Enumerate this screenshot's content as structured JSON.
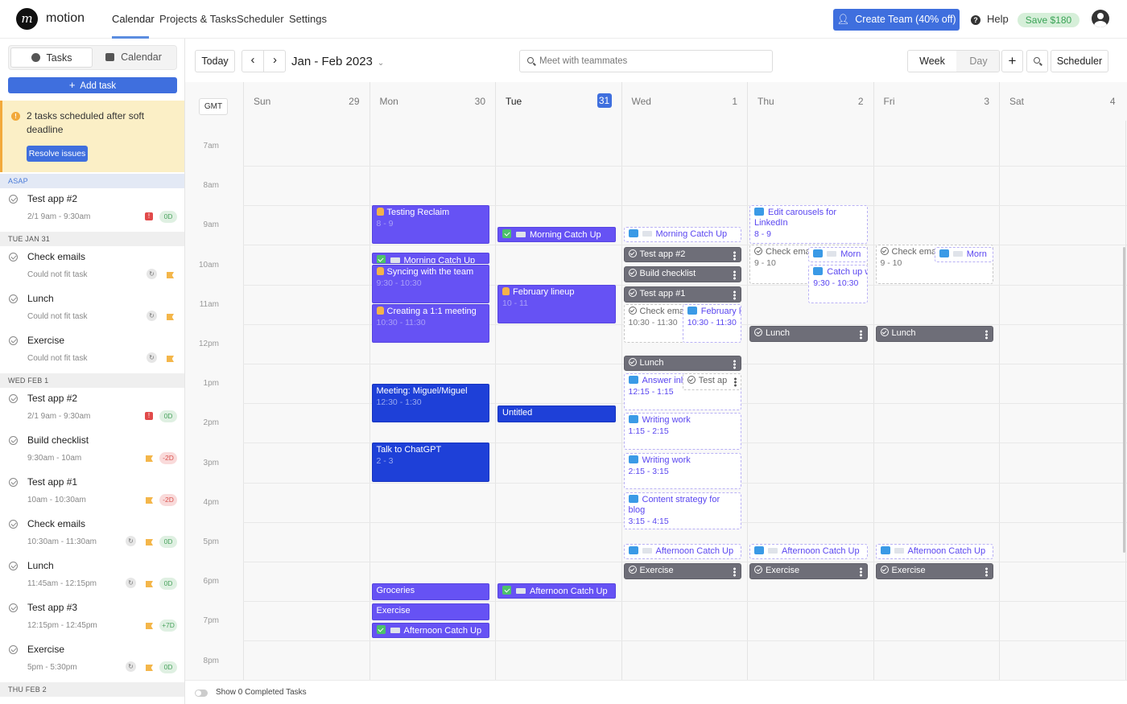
{
  "app": {
    "brand": "motion",
    "logo_glyph": "m"
  },
  "nav": {
    "items": [
      "Calendar",
      "Projects & Tasks",
      "Scheduler",
      "Settings"
    ],
    "active": "Calendar"
  },
  "header_right": {
    "create_team": "Create Team (40% off)",
    "help": "Help",
    "save": "Save $180"
  },
  "sidebar": {
    "tabs": [
      "Tasks",
      "Calendar"
    ],
    "active_tab": "Tasks",
    "add_task": "Add task",
    "warning": {
      "text": "2 tasks scheduled after soft deadline",
      "button": "Resolve issues"
    },
    "sections": [
      {
        "label": "ASAP",
        "tasks": [
          {
            "name": "Test app #2",
            "sub": "2/1 9am - 9:30am",
            "badges": [
              "error"
            ],
            "day": "0D",
            "day_tone": "green"
          }
        ]
      },
      {
        "label": "TUE JAN 31",
        "tasks": [
          {
            "name": "Check emails",
            "sub": "Could not fit task",
            "badges": [
              "recurring",
              "flag"
            ],
            "day": "",
            "day_tone": ""
          },
          {
            "name": "Lunch",
            "sub": "Could not fit task",
            "badges": [
              "recurring",
              "flag"
            ],
            "day": "",
            "day_tone": ""
          },
          {
            "name": "Exercise",
            "sub": "Could not fit task",
            "badges": [
              "recurring",
              "flag"
            ],
            "day": "",
            "day_tone": ""
          }
        ]
      },
      {
        "label": "WED FEB 1",
        "tasks": [
          {
            "name": "Test app #2",
            "sub": "2/1 9am - 9:30am",
            "badges": [
              "error"
            ],
            "day": "0D",
            "day_tone": "green"
          },
          {
            "name": "Build checklist",
            "sub": "9:30am - 10am",
            "badges": [
              "flag"
            ],
            "day": "-2D",
            "day_tone": "red"
          },
          {
            "name": "Test app #1",
            "sub": "10am - 10:30am",
            "badges": [
              "flag"
            ],
            "day": "-2D",
            "day_tone": "red"
          },
          {
            "name": "Check emails",
            "sub": "10:30am - 11:30am",
            "badges": [
              "recurring",
              "flag"
            ],
            "day": "0D",
            "day_tone": "green"
          },
          {
            "name": "Lunch",
            "sub": "11:45am - 12:15pm",
            "badges": [
              "recurring",
              "flag"
            ],
            "day": "0D",
            "day_tone": "green"
          },
          {
            "name": "Test app #3",
            "sub": "12:15pm - 12:45pm",
            "badges": [
              "flag"
            ],
            "day": "+7D",
            "day_tone": "green"
          },
          {
            "name": "Exercise",
            "sub": "5pm - 5:30pm",
            "badges": [
              "recurring",
              "flag"
            ],
            "day": "0D",
            "day_tone": "green"
          }
        ]
      },
      {
        "label": "THU FEB 2",
        "tasks": []
      }
    ]
  },
  "toolbar": {
    "today": "Today",
    "prev": "‹",
    "next": "›",
    "range": "Jan - Feb 2023",
    "search_placeholder": "Meet with teammates",
    "week": "Week",
    "day": "Day",
    "add": "+",
    "scheduler": "Scheduler",
    "timezone": "GMT"
  },
  "days": [
    {
      "name": "Sun",
      "date": "29",
      "today": false
    },
    {
      "name": "Mon",
      "date": "30",
      "today": false
    },
    {
      "name": "Tue",
      "date": "31",
      "today": true
    },
    {
      "name": "Wed",
      "date": "1",
      "today": false
    },
    {
      "name": "Thu",
      "date": "2",
      "today": false
    },
    {
      "name": "Fri",
      "date": "3",
      "today": false
    },
    {
      "name": "Sat",
      "date": "4",
      "today": false
    }
  ],
  "hours": [
    "7am",
    "8am",
    "9am",
    "10am",
    "11am",
    "12pm",
    "1pm",
    "2pm",
    "3pm",
    "4pm",
    "5pm",
    "6pm",
    "7pm",
    "8pm"
  ],
  "events": [
    {
      "day": 1,
      "start": 8,
      "end": 9,
      "lane": 0,
      "lanes": 1,
      "style": "purple",
      "icon": "thumb",
      "title": "Testing Reclaim",
      "time": "8 - 9"
    },
    {
      "day": 1,
      "start": 9.2,
      "end": 9.5,
      "lane": 0,
      "lanes": 1,
      "style": "purple",
      "icon": "check-env",
      "title": "Morning Catch Up",
      "time": ""
    },
    {
      "day": 1,
      "start": 9.5,
      "end": 10.5,
      "lane": 0,
      "lanes": 1,
      "style": "purple",
      "icon": "thumb",
      "title": "Syncing with the team",
      "time": "9:30 - 10:30"
    },
    {
      "day": 1,
      "start": 10.5,
      "end": 11.5,
      "lane": 0,
      "lanes": 1,
      "style": "purple",
      "icon": "thumb",
      "title": "Creating a 1:1 meeting",
      "time": "10:30 - 11:30"
    },
    {
      "day": 1,
      "start": 12.5,
      "end": 13.5,
      "lane": 0,
      "lanes": 1,
      "style": "blue",
      "icon": "",
      "title": "Meeting: Miguel/Miguel",
      "time": "12:30 - 1:30"
    },
    {
      "day": 1,
      "start": 14,
      "end": 15,
      "lane": 0,
      "lanes": 1,
      "style": "blue",
      "icon": "",
      "title": "Talk to ChatGPT",
      "time": "2 - 3"
    },
    {
      "day": 1,
      "start": 17.55,
      "end": 18,
      "lane": 0,
      "lanes": 1,
      "style": "purple",
      "icon": "",
      "title": "Groceries",
      "time": ""
    },
    {
      "day": 1,
      "start": 18.05,
      "end": 18.5,
      "lane": 0,
      "lanes": 1,
      "style": "purple",
      "icon": "",
      "title": "Exercise",
      "time": ""
    },
    {
      "day": 1,
      "start": 18.55,
      "end": 18.95,
      "lane": 0,
      "lanes": 1,
      "style": "purple",
      "icon": "check-env",
      "title": "Afternoon Catch Up",
      "time": ""
    },
    {
      "day": 2,
      "start": 8.55,
      "end": 8.95,
      "lane": 0,
      "lanes": 1,
      "style": "purple",
      "icon": "check-env",
      "title": "Morning Catch Up",
      "time": ""
    },
    {
      "day": 2,
      "start": 10,
      "end": 11,
      "lane": 0,
      "lanes": 1,
      "style": "purple",
      "icon": "thumb",
      "title": "February lineup",
      "time": "10 - 11"
    },
    {
      "day": 2,
      "start": 13.05,
      "end": 13.5,
      "lane": 0,
      "lanes": 1,
      "style": "blue",
      "icon": "",
      "title": "Untitled",
      "time": ""
    },
    {
      "day": 2,
      "start": 17.55,
      "end": 17.95,
      "lane": 0,
      "lanes": 1,
      "style": "purple",
      "icon": "check-env",
      "title": "Afternoon Catch Up",
      "time": ""
    },
    {
      "day": 3,
      "start": 8.55,
      "end": 8.95,
      "lane": 0,
      "lanes": 1,
      "style": "dashed",
      "icon": "free-env",
      "title": "Morning Catch Up",
      "time": ""
    },
    {
      "day": 3,
      "start": 9.05,
      "end": 9.47,
      "lane": 0,
      "lanes": 1,
      "style": "gray",
      "icon": "circle",
      "title": "Test app #2",
      "time": ""
    },
    {
      "day": 3,
      "start": 9.55,
      "end": 9.97,
      "lane": 0,
      "lanes": 1,
      "style": "gray",
      "icon": "circle",
      "title": "Build checklist",
      "time": ""
    },
    {
      "day": 3,
      "start": 10.05,
      "end": 10.47,
      "lane": 0,
      "lanes": 1,
      "style": "gray",
      "icon": "circle",
      "title": "Test app #1",
      "time": ""
    },
    {
      "day": 3,
      "start": 10.5,
      "end": 11.5,
      "lane": 0,
      "lanes": 2,
      "style": "dashed-gray",
      "icon": "circle",
      "title": "Check ema",
      "time": "10:30 - 11:30"
    },
    {
      "day": 3,
      "start": 10.5,
      "end": 11.5,
      "lane": 1,
      "lanes": 2,
      "style": "dashed",
      "icon": "free",
      "title": "February lineup",
      "time": "10:30 - 11:30"
    },
    {
      "day": 3,
      "start": 11.8,
      "end": 12.2,
      "lane": 0,
      "lanes": 1,
      "style": "gray",
      "icon": "circle",
      "title": "Lunch",
      "time": ""
    },
    {
      "day": 3,
      "start": 12.25,
      "end": 13.2,
      "lane": 0,
      "lanes": 1,
      "style": "dashed",
      "icon": "free",
      "title": "Answer inl",
      "time": "12:15 - 1:15"
    },
    {
      "day": 3,
      "start": 12.25,
      "end": 12.7,
      "lane": 1,
      "lanes": 2,
      "style": "dashed-gray",
      "icon": "circle",
      "title": "Test ap",
      "time": ""
    },
    {
      "day": 3,
      "start": 13.25,
      "end": 14.2,
      "lane": 0,
      "lanes": 1,
      "style": "dashed",
      "icon": "free",
      "title": "Writing work",
      "time": "1:15 - 2:15"
    },
    {
      "day": 3,
      "start": 14.25,
      "end": 15.2,
      "lane": 0,
      "lanes": 1,
      "style": "dashed",
      "icon": "free",
      "title": "Writing work",
      "time": "2:15 - 3:15"
    },
    {
      "day": 3,
      "start": 15.25,
      "end": 16.2,
      "lane": 0,
      "lanes": 1,
      "style": "dashed",
      "icon": "free",
      "title": "Content strategy for blog",
      "time": "3:15 - 4:15"
    },
    {
      "day": 3,
      "start": 16.55,
      "end": 16.95,
      "lane": 0,
      "lanes": 1,
      "style": "dashed",
      "icon": "free-env",
      "title": "Afternoon Catch Up",
      "time": ""
    },
    {
      "day": 3,
      "start": 17.05,
      "end": 17.47,
      "lane": 0,
      "lanes": 1,
      "style": "gray",
      "icon": "circle",
      "title": "Exercise",
      "time": ""
    },
    {
      "day": 4,
      "start": 8,
      "end": 9,
      "lane": 0,
      "lanes": 1,
      "style": "dashed",
      "icon": "free",
      "title": "Edit carousels for LinkedIn",
      "time": "8 - 9"
    },
    {
      "day": 4,
      "start": 9,
      "end": 10,
      "lane": 0,
      "lanes": 1,
      "style": "dashed-gray",
      "icon": "circle",
      "title": "Check ema",
      "time": "9 - 10"
    },
    {
      "day": 4,
      "start": 9.05,
      "end": 9.45,
      "lane": 1,
      "lanes": 2,
      "style": "dashed",
      "icon": "free-env",
      "title": "Morn",
      "time": ""
    },
    {
      "day": 4,
      "start": 9.5,
      "end": 10.5,
      "lane": 1,
      "lanes": 2,
      "style": "dashed",
      "icon": "free",
      "title": "Catch up with Sam",
      "time": "9:30 - 10:30"
    },
    {
      "day": 4,
      "start": 11.05,
      "end": 11.47,
      "lane": 0,
      "lanes": 1,
      "style": "gray",
      "icon": "circle",
      "title": "Lunch",
      "time": ""
    },
    {
      "day": 4,
      "start": 16.55,
      "end": 16.95,
      "lane": 0,
      "lanes": 1,
      "style": "dashed",
      "icon": "free-env",
      "title": "Afternoon Catch Up",
      "time": ""
    },
    {
      "day": 4,
      "start": 17.05,
      "end": 17.47,
      "lane": 0,
      "lanes": 1,
      "style": "gray",
      "icon": "circle",
      "title": "Exercise",
      "time": ""
    },
    {
      "day": 5,
      "start": 9,
      "end": 10,
      "lane": 0,
      "lanes": 1,
      "style": "dashed-gray",
      "icon": "circle",
      "title": "Check ema",
      "time": "9 - 10"
    },
    {
      "day": 5,
      "start": 9.05,
      "end": 9.45,
      "lane": 1,
      "lanes": 2,
      "style": "dashed",
      "icon": "free-env",
      "title": "Morn",
      "time": ""
    },
    {
      "day": 5,
      "start": 11.05,
      "end": 11.47,
      "lane": 0,
      "lanes": 1,
      "style": "gray",
      "icon": "circle",
      "title": "Lunch",
      "time": ""
    },
    {
      "day": 5,
      "start": 16.55,
      "end": 16.95,
      "lane": 0,
      "lanes": 1,
      "style": "dashed",
      "icon": "free-env",
      "title": "Afternoon Catch Up",
      "time": ""
    },
    {
      "day": 5,
      "start": 17.05,
      "end": 17.47,
      "lane": 0,
      "lanes": 1,
      "style": "gray",
      "icon": "circle",
      "title": "Exercise",
      "time": ""
    }
  ],
  "footer": {
    "completed_toggle": "Show 0 Completed Tasks"
  }
}
